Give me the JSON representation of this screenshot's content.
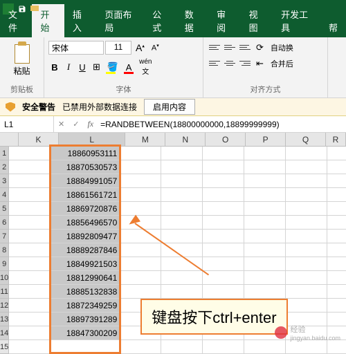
{
  "titlebar": {
    "save_icon": "save-icon",
    "undo_icon": "undo-icon",
    "redo_icon": "redo-icon"
  },
  "menu": {
    "file": "文件",
    "home": "开始",
    "insert": "插入",
    "layout": "页面布局",
    "formulas": "公式",
    "data": "数据",
    "review": "审阅",
    "view": "视图",
    "developer": "开发工具",
    "help": "帮"
  },
  "ribbon": {
    "clipboard": {
      "paste": "粘贴",
      "group": "剪贴板"
    },
    "font": {
      "name": "宋体",
      "size": "11",
      "group": "字体",
      "increase": "A",
      "decrease": "A"
    },
    "align": {
      "group": "对齐方式",
      "wrap": "自动换",
      "merge": "合并后"
    }
  },
  "security": {
    "label": "安全警告",
    "msg": "已禁用外部数据连接",
    "enable": "启用内容"
  },
  "namebox": {
    "ref": "L1",
    "formula": "=RANDBETWEEN(18800000000,18899999999)"
  },
  "columns": [
    "K",
    "L",
    "M",
    "N",
    "O",
    "P",
    "Q",
    "R"
  ],
  "rows": [
    "1",
    "2",
    "3",
    "4",
    "5",
    "6",
    "7",
    "8",
    "9",
    "10",
    "11",
    "12",
    "13",
    "14",
    "15"
  ],
  "data_L": [
    "18860953111",
    "18870530573",
    "18884991057",
    "18861561721",
    "18869720876",
    "18856496570",
    "18892809477",
    "18889287846",
    "18849921503",
    "18812990641",
    "18885132838",
    "18872349259",
    "18897391289",
    "18847300209",
    ""
  ],
  "callout": "键盘按下ctrl+enter",
  "watermark": {
    "brand": "经验",
    "url": "jingyan.baidu.com"
  }
}
